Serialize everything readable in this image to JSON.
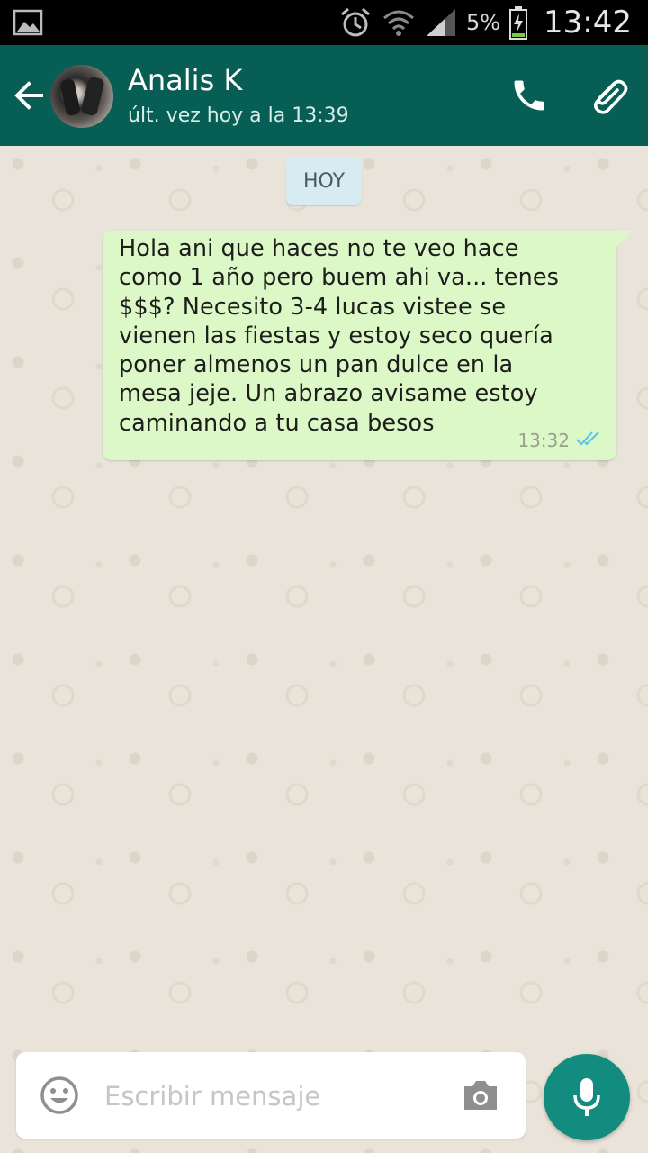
{
  "status_bar": {
    "battery_percent": "5%",
    "time": "13:42",
    "icons": [
      "gallery-icon",
      "alarm-icon",
      "wifi-icon",
      "signal-icon",
      "battery-icon"
    ]
  },
  "header": {
    "contact_name": "Analis K",
    "last_seen": "últ. vez hoy a la 13:39",
    "icons": [
      "back-arrow-icon",
      "avatar",
      "phone-icon",
      "paperclip-icon"
    ],
    "color": "#075e54"
  },
  "chat": {
    "day_label": "HOY",
    "messages": [
      {
        "direction": "outgoing",
        "text": "Hola ani que haces no te veo hace\ncomo 1 año pero buem ahi va... tenes\n$$$? Necesito 3-4 lucas vistee se\nvienen las fiestas y estoy seco quería\nponer almenos un pan dulce en la\nmesa jeje. Un abrazo avisame estoy\ncaminando a tu casa besos",
        "time": "13:32",
        "status": "read",
        "bubble_color": "#dcf8c6"
      }
    ]
  },
  "composer": {
    "placeholder": "Escribir mensaje",
    "icons": [
      "emoji-icon",
      "camera-icon",
      "microphone-icon"
    ],
    "mic_color": "#128c7e"
  }
}
